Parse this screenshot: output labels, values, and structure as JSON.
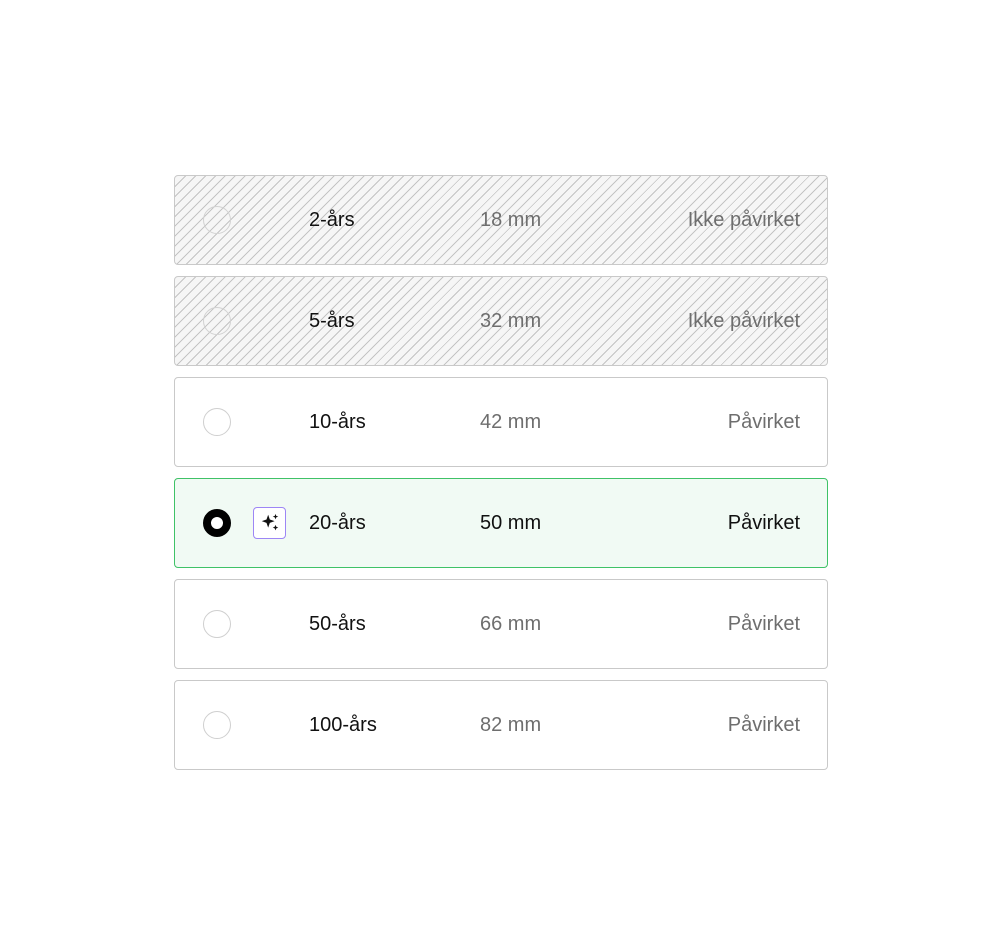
{
  "options": [
    {
      "period": "2-års",
      "depth": "18 mm",
      "status": "Ikke påvirket",
      "state": "disabled"
    },
    {
      "period": "5-års",
      "depth": "32 mm",
      "status": "Ikke påvirket",
      "state": "disabled"
    },
    {
      "period": "10-års",
      "depth": "42 mm",
      "status": "Påvirket",
      "state": "normal"
    },
    {
      "period": "20-års",
      "depth": "50 mm",
      "status": "Påvirket",
      "state": "selected",
      "badge_icon": "sparkles-icon"
    },
    {
      "period": "50-års",
      "depth": "66 mm",
      "status": "Påvirket",
      "state": "normal"
    },
    {
      "period": "100-års",
      "depth": "82 mm",
      "status": "Påvirket",
      "state": "normal"
    }
  ],
  "colors": {
    "selected_border": "#3fc267",
    "selected_background": "#f1faf4",
    "badge_border": "#9d86f5"
  }
}
